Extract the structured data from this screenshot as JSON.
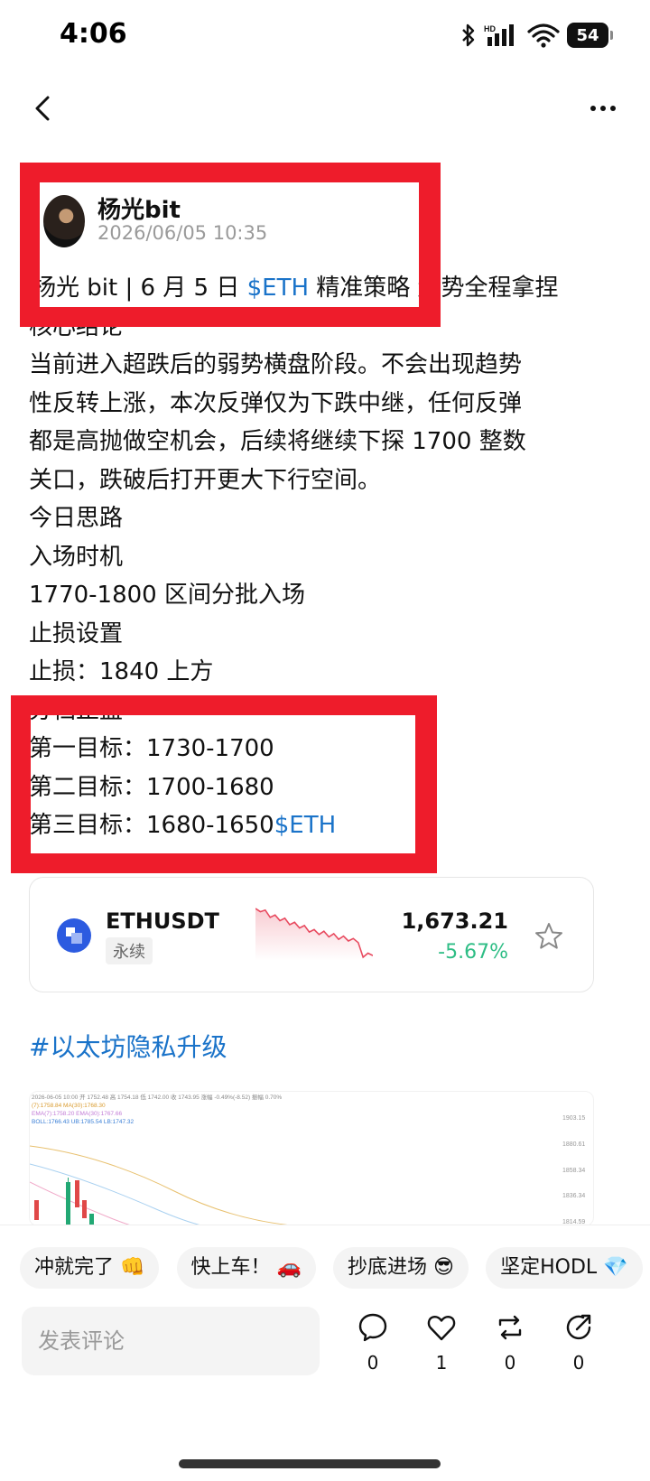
{
  "status_bar": {
    "time": "4:06",
    "battery": "54",
    "network": "HD"
  },
  "post": {
    "author_name": "杨光bit",
    "timestamp": "2026/06/05 10:35",
    "title": {
      "prefix": "杨光 bit | 6 月 5 日 ",
      "tag": "$ETH",
      "suffix": " 精准策略 趋势全程拿捏"
    },
    "lines": [
      "核心结论",
      "当前进入超跌后的弱势横盘阶段。不会出现趋势",
      "性反转上涨，本次反弹仅为下跌中继，任何反弹",
      "都是高抛做空机会，后续将继续下探 1700 整数",
      "关口，跌破后打开更大下行空间。",
      "今日思路",
      "入场时机",
      "1770-1800 区间分批入场",
      "止损设置",
      "止损：1840 上方",
      "分档止盈",
      "第一目标：1730-1700",
      "第二目标：1700-1680"
    ],
    "last_line": {
      "text": "第三目标：1680-1650",
      "tag": "$ETH"
    }
  },
  "ticker": {
    "symbol": "ETHUSDT",
    "type": "永续",
    "price": "1,673.21",
    "change": "-5.67%",
    "change_color": "#2ebd85",
    "sparkline_color": "#e84a5f",
    "sparkline": [
      1800,
      1796,
      1798,
      1789,
      1792,
      1785,
      1788,
      1780,
      1783,
      1776,
      1779,
      1771,
      1774,
      1768,
      1772,
      1765,
      1769,
      1762,
      1766,
      1760,
      1763,
      1758,
      1740,
      1745,
      1742
    ]
  },
  "hashtag": "#以太坊隐私升级",
  "chart_image": {
    "header_lines": [
      "2026-06-05 10:00  开 1752.48  高 1754.18  低 1742.00  收 1743.95  涨幅 -0.49%(-8.52)  振幅 0.70%",
      "(7):1758.84  MA(30):1768.30",
      "EMA(7):1758.20  EMA(30):1767.66",
      "BOLL:1766.43  UB:1785.54  LB:1747.32"
    ],
    "price_ticks": [
      "1903.15",
      "1880.61",
      "1858.34",
      "1836.34",
      "1814.59"
    ]
  },
  "quick_replies": [
    {
      "label": "冲就完了",
      "emoji": "👊"
    },
    {
      "label": "快上车！",
      "emoji": "🚗"
    },
    {
      "label": "抄底进场",
      "emoji": "😎"
    },
    {
      "label": "坚定HODL",
      "emoji": "💎"
    }
  ],
  "comment_placeholder": "发表评论",
  "actions": {
    "comment_count": "0",
    "like_count": "1",
    "repost_count": "0",
    "share_count": "0"
  },
  "colors": {
    "highlight_red": "#ee1c2b",
    "link_blue": "#1a73c9"
  }
}
